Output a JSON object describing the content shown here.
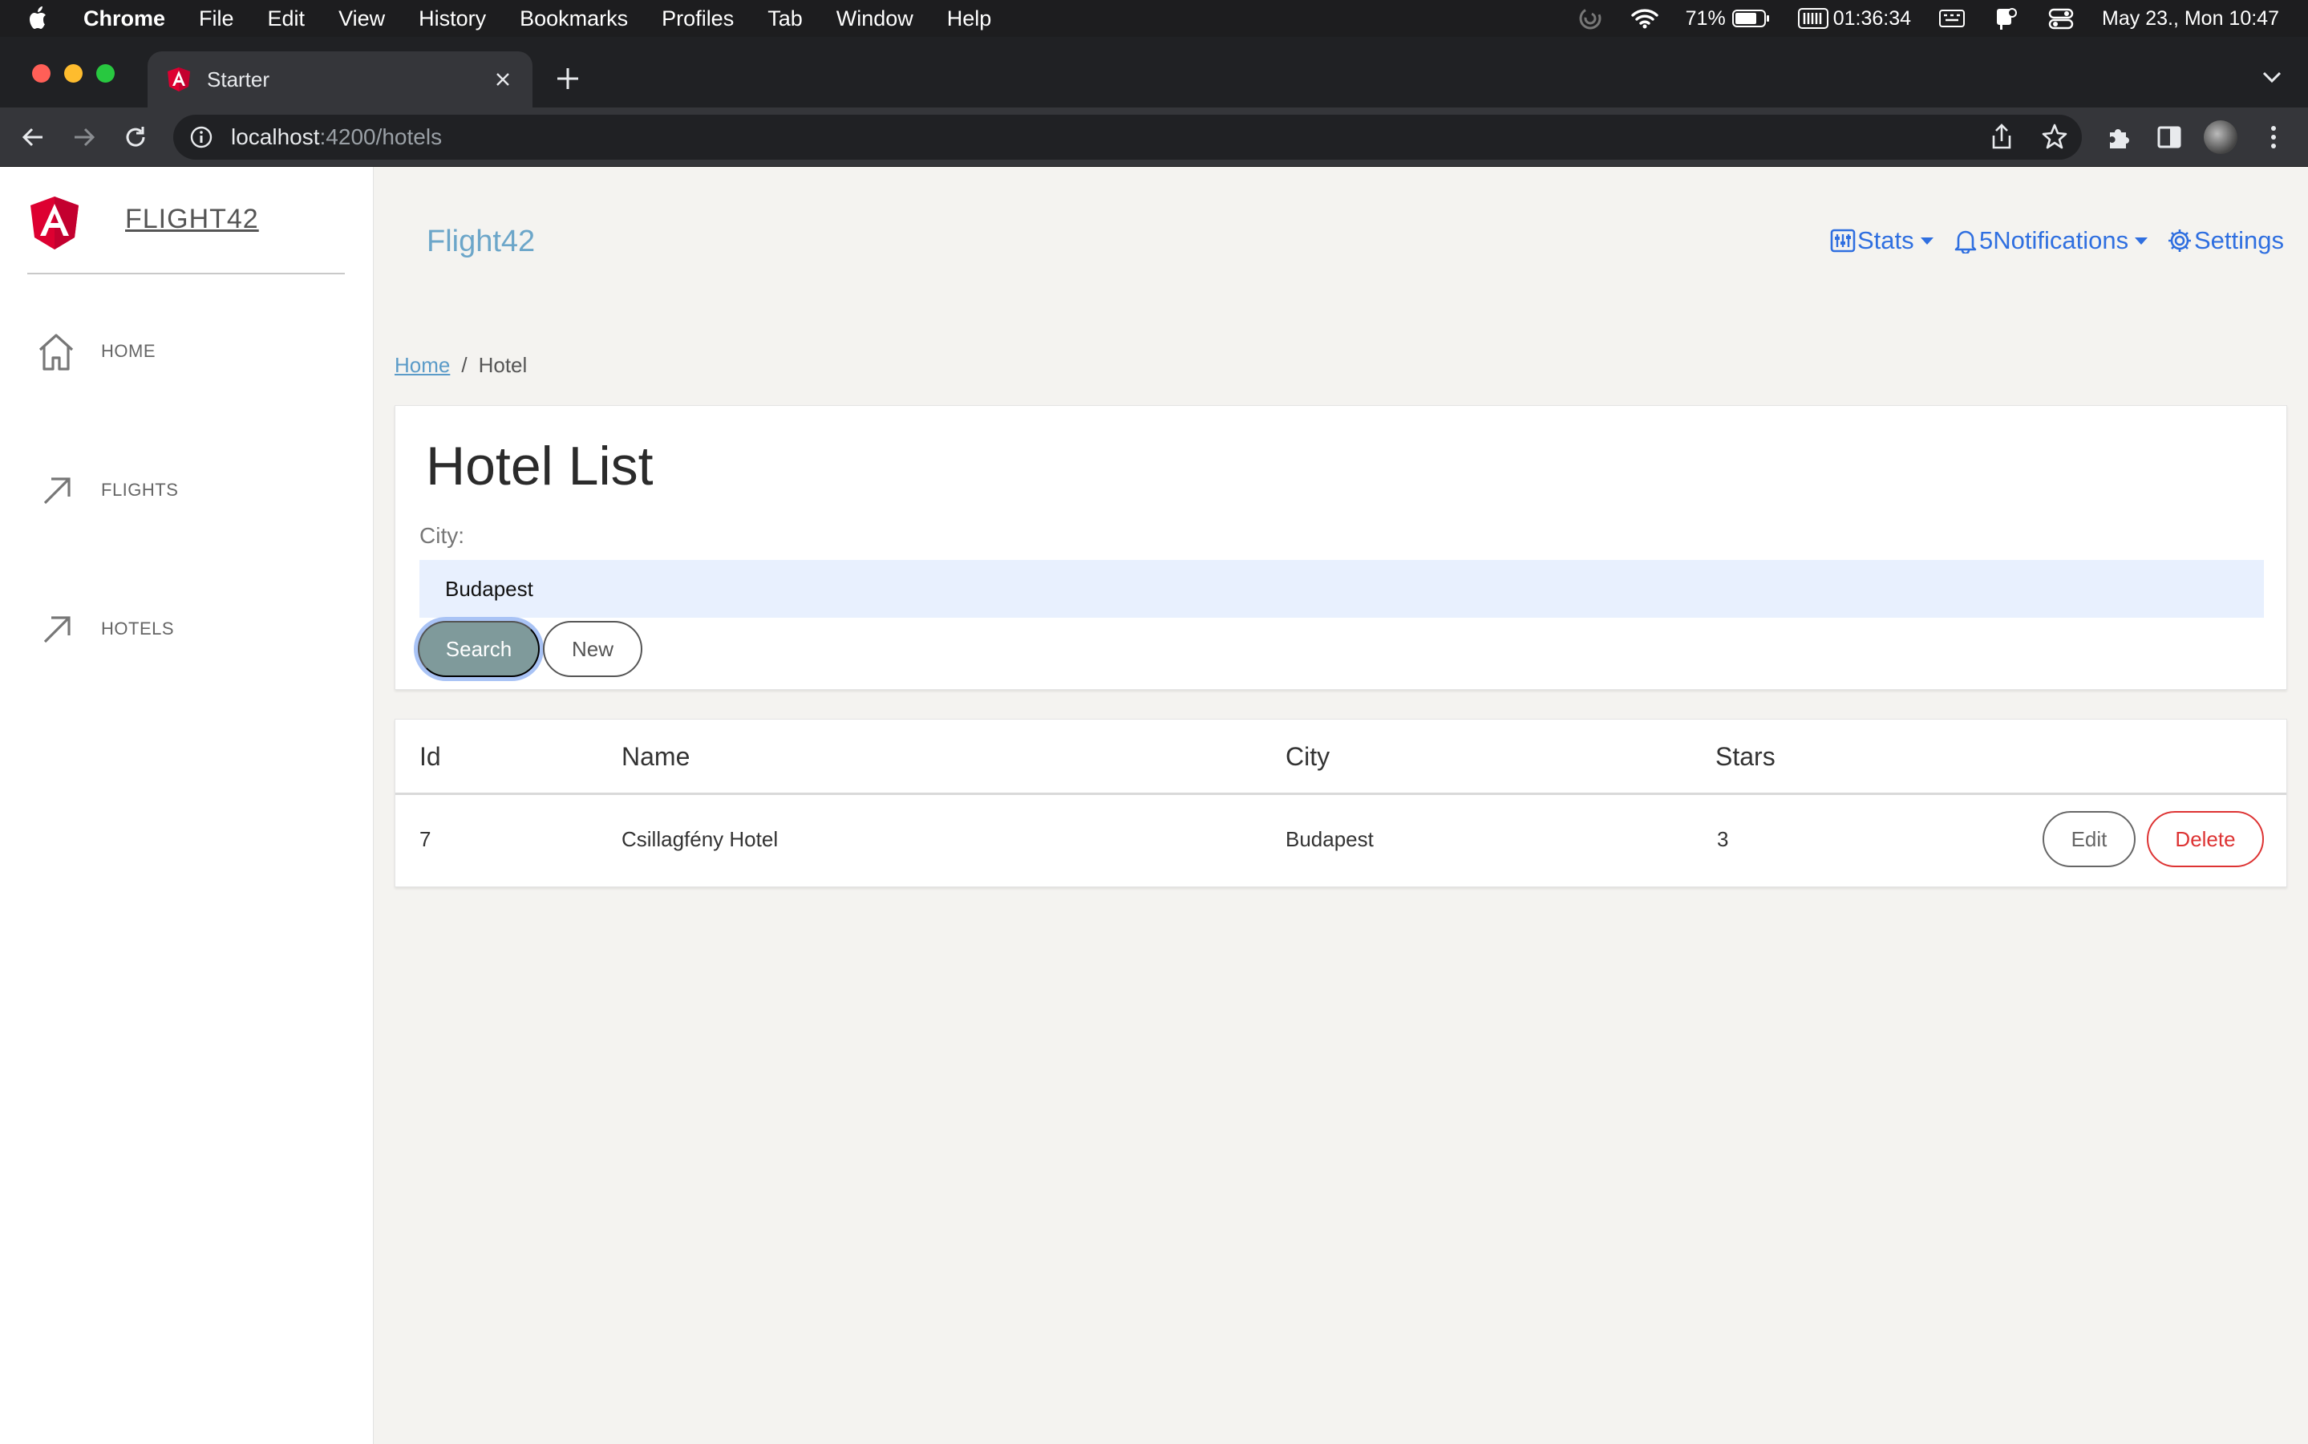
{
  "menubar": {
    "app": "Chrome",
    "items": [
      "File",
      "Edit",
      "View",
      "History",
      "Bookmarks",
      "Profiles",
      "Tab",
      "Window",
      "Help"
    ],
    "battery_pct": "71%",
    "timer": "01:36:34",
    "datetime": "May 23., Mon  10:47"
  },
  "browser": {
    "tab_title": "Starter",
    "url_host": "localhost",
    "url_path": ":4200/hotels"
  },
  "sidebar": {
    "brand": "FLIGHT42",
    "items": [
      {
        "label": "HOME",
        "icon": "home-icon"
      },
      {
        "label": "FLIGHTS",
        "icon": "arrow-up-right-icon"
      },
      {
        "label": "HOTELS",
        "icon": "arrow-up-right-icon"
      }
    ]
  },
  "topnav": {
    "brand": "Flight42",
    "stats": "Stats",
    "notifications_count": "5",
    "notifications": "Notifications",
    "settings": "Settings"
  },
  "breadcrumb": {
    "home": "Home",
    "separator": "/",
    "current": "Hotel"
  },
  "search_card": {
    "title": "Hotel List",
    "city_label": "City:",
    "city_value": "Budapest",
    "search_button": "Search",
    "new_button": "New"
  },
  "table": {
    "headers": {
      "id": "Id",
      "name": "Name",
      "city": "City",
      "stars": "Stars"
    },
    "rows": [
      {
        "id": "7",
        "name": "Csillagfény Hotel",
        "city": "Budapest",
        "stars": "3",
        "edit": "Edit",
        "delete": "Delete"
      }
    ]
  },
  "colors": {
    "link_blue": "#2f6fe0",
    "brand_teal": "#6ca6c9",
    "search_button": "#7f9a9b",
    "delete_red": "#d33333",
    "angular_red": "#dd0031"
  }
}
